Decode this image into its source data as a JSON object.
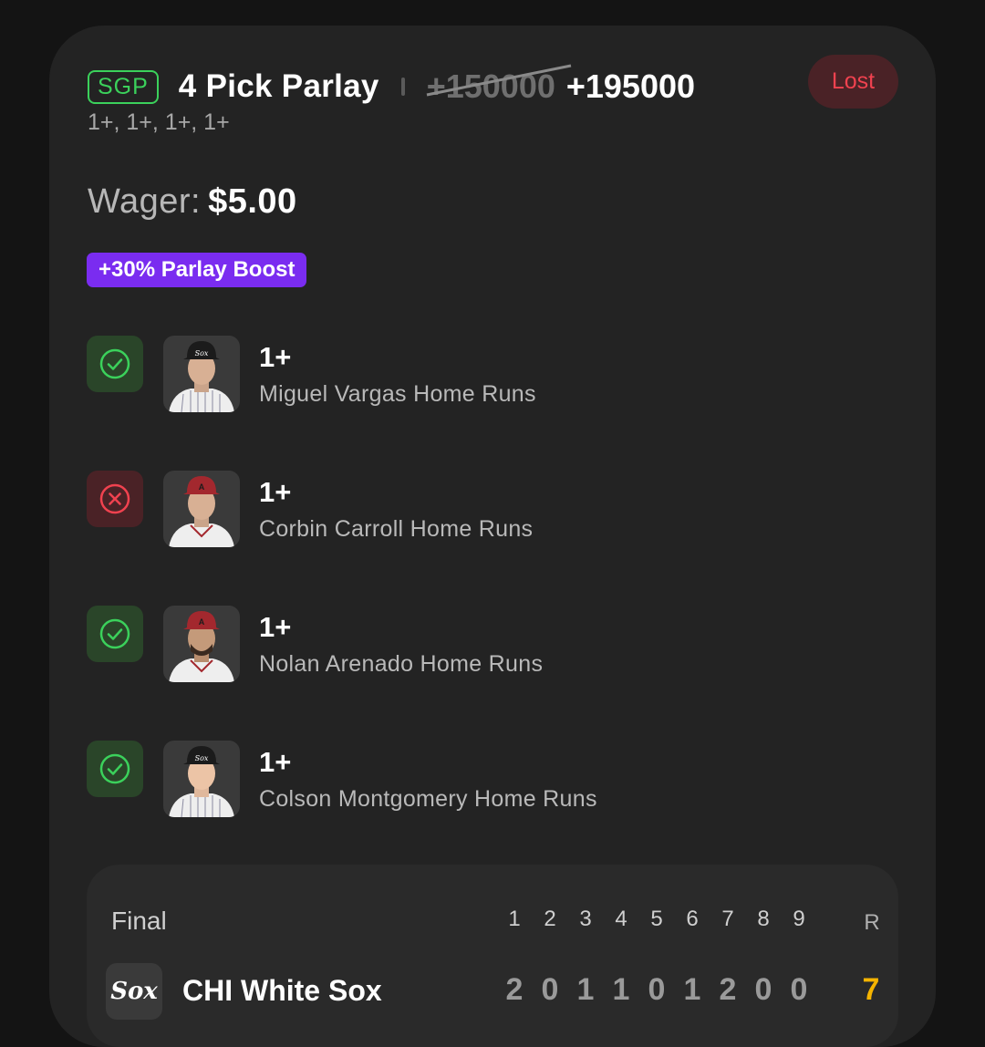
{
  "bet": {
    "badge": "SGP",
    "title": "4 Pick Parlay",
    "old_odds": "+150000",
    "new_odds": "+195000",
    "status": "Lost",
    "subtitle": "1+, 1+, 1+, 1+",
    "wager_label": "Wager:",
    "wager_amount": "$5.00",
    "boost": "+30% Parlay Boost"
  },
  "picks": [
    {
      "result": "win",
      "line": "1+",
      "desc": "Miguel Vargas Home Runs",
      "cap_color": "#1b1b1b"
    },
    {
      "result": "loss",
      "line": "1+",
      "desc": "Corbin Carroll Home Runs",
      "cap_color": "#a3282e"
    },
    {
      "result": "win",
      "line": "1+",
      "desc": "Nolan Arenado Home Runs",
      "cap_color": "#a3282e"
    },
    {
      "result": "win",
      "line": "1+",
      "desc": "Colson Montgomery Home Runs",
      "cap_color": "#1b1b1b"
    }
  ],
  "scoreboard": {
    "status": "Final",
    "innings": [
      "1",
      "2",
      "3",
      "4",
      "5",
      "6",
      "7",
      "8",
      "9"
    ],
    "runs_label": "R",
    "team": {
      "logo": "Sox",
      "name": "CHI White Sox",
      "scores": [
        "2",
        "0",
        "1",
        "1",
        "0",
        "1",
        "2",
        "0",
        "0"
      ],
      "total": "7"
    }
  },
  "colors": {
    "win": "#3bd15b",
    "loss": "#f0424f",
    "boost": "#7a2cf0",
    "total": "#f5b400"
  }
}
